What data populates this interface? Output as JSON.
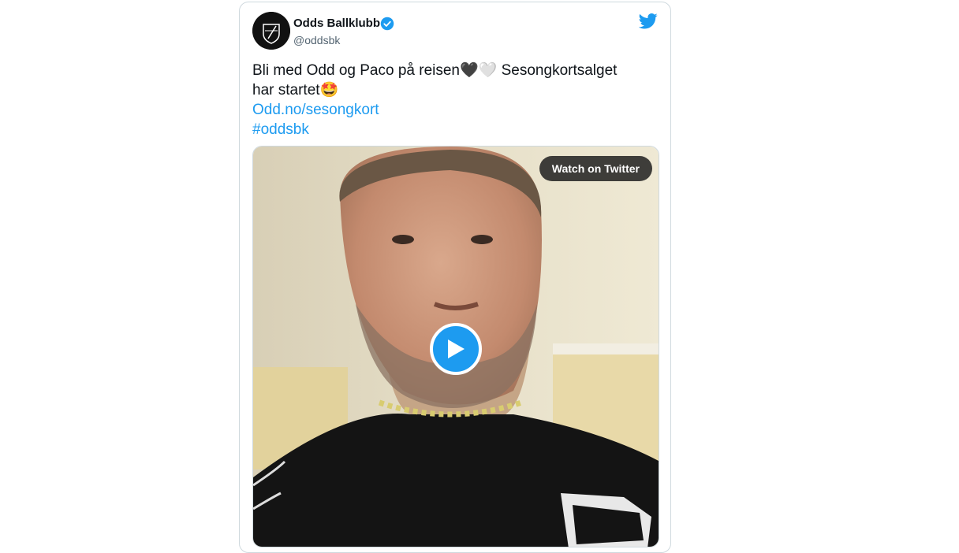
{
  "tweet": {
    "display_name": "Odds Ballklubb",
    "handle": "@oddsbk",
    "text_line1": "Bli med Odd og Paco på reisen",
    "heart_black": "🖤",
    "heart_white": "🤍",
    "text_line1_rest": " Sesongkortsalget",
    "text_line2": "har startet",
    "star_emoji": "🤩",
    "link": "Odd.no/sesongkort",
    "hashtag": "#oddsbk"
  },
  "video": {
    "watch_label": "Watch on Twitter"
  },
  "icons": {
    "verified": "verified-badge-icon",
    "bird": "twitter-bird-icon",
    "play": "play-icon"
  },
  "colors": {
    "accent": "#1d9bf0",
    "text": "#0f1419",
    "muted": "#536471"
  }
}
